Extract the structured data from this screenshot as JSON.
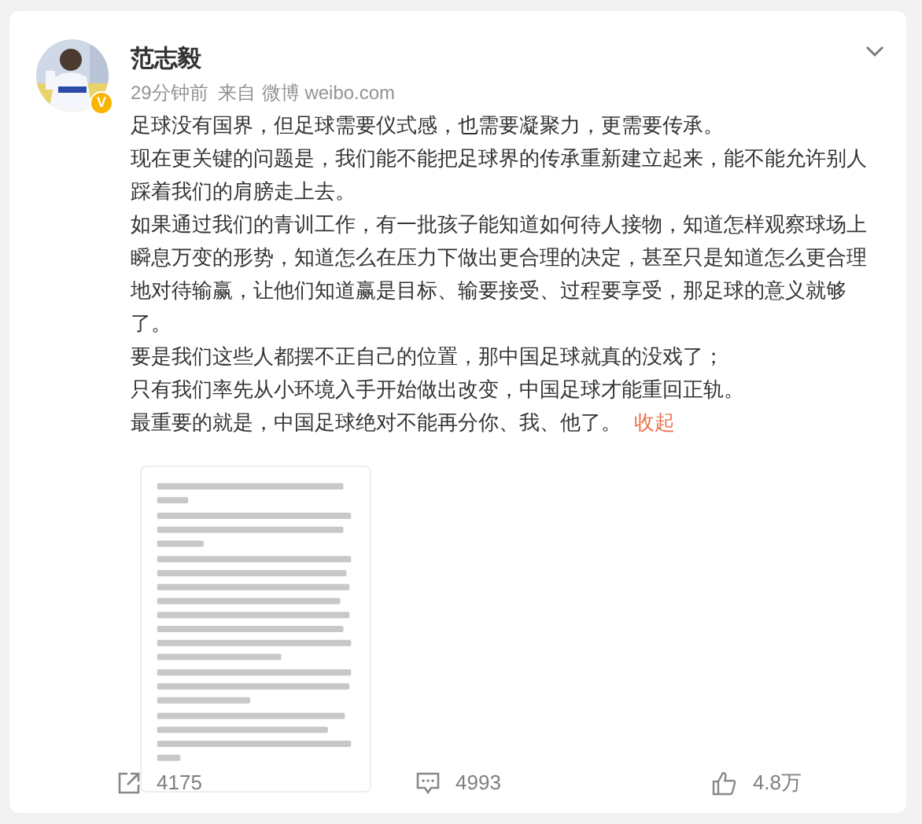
{
  "author": {
    "name": "范志毅",
    "verified_badge": "V",
    "time": "29分钟前",
    "source_prefix": "来自",
    "source": "微博 weibo.com"
  },
  "paragraphs": [
    "足球没有国界，但足球需要仪式感，也需要凝聚力，更需要传承。",
    "现在更关键的问题是，我们能不能把足球界的传承重新建立起来，能不能允许别人踩着我们的肩膀走上去。",
    "如果通过我们的青训工作，有一批孩子能知道如何待人接物，知道怎样观察球场上瞬息万变的形势，知道怎么在压力下做出更合理的决定，甚至只是知道怎么更合理地对待输赢，让他们知道赢是目标、输要接受、过程要享受，那足球的意义就够了。",
    "要是我们这些人都摆不正自己的位置，那中国足球就真的没戏了；",
    "只有我们率先从小环境入手开始做出改变，中国足球才能重回正轨。",
    "最重要的就是，中国足球绝对不能再分你、我、他了。"
  ],
  "collapse_link": "收起",
  "actions": [
    {
      "kind": "share",
      "count": "4175"
    },
    {
      "kind": "comment",
      "count": "4993"
    },
    {
      "kind": "like",
      "count": "4.8万"
    }
  ]
}
